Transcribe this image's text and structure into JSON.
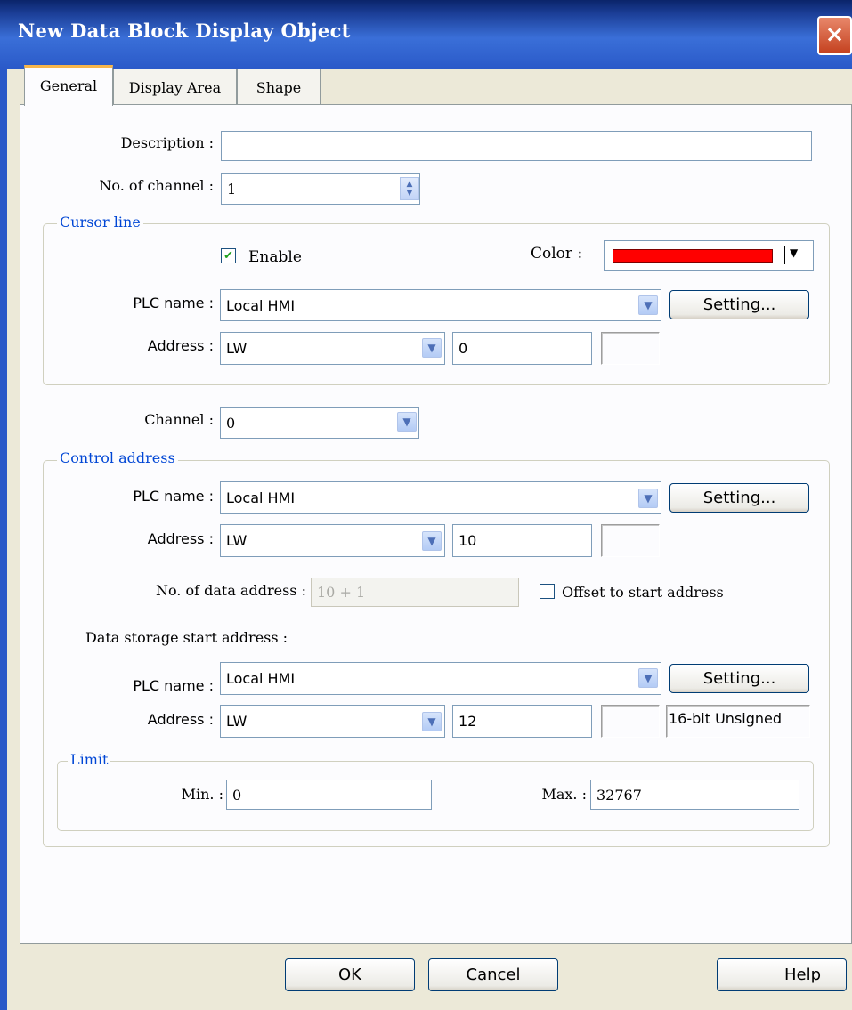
{
  "window": {
    "title": "New  Data Block Display Object",
    "close": "×"
  },
  "tabs": [
    {
      "label": "General",
      "active": true
    },
    {
      "label": "Display Area",
      "active": false
    },
    {
      "label": "Shape",
      "active": false
    }
  ],
  "general": {
    "description_label": "Description :",
    "description_value": "",
    "channels_label": "No. of channel :",
    "channels_value": "1"
  },
  "cursor_line": {
    "title": "Cursor line",
    "enable_label": "Enable",
    "enable_checked": true,
    "color_label": "Color :",
    "color_value": "#ff0000",
    "plc_label": "PLC name :",
    "plc_value": "Local HMI",
    "setting_label": "Setting...",
    "address_label": "Address :",
    "address_device": "LW",
    "address_value": "0"
  },
  "channel": {
    "label": "Channel :",
    "value": "0"
  },
  "control_address": {
    "title": "Control address",
    "plc_label": "PLC name :",
    "plc_value": "Local HMI",
    "setting_label": "Setting...",
    "address_label": "Address :",
    "address_device": "LW",
    "address_value": "10",
    "data_count_label": "No. of data address :",
    "data_count_value": "10 + 1",
    "offset_label": "Offset to start address",
    "offset_checked": false
  },
  "data_storage": {
    "title": "Data storage start address :",
    "plc_label": "PLC name :",
    "plc_value": "Local HMI",
    "setting_label": "Setting...",
    "address_label": "Address :",
    "address_device": "LW",
    "address_value": "12",
    "format": "16-bit Unsigned"
  },
  "limit": {
    "title": "Limit",
    "min_label": "Min. :",
    "min_value": "0",
    "max_label": "Max. :",
    "max_value": "32767"
  },
  "footer": {
    "ok": "OK",
    "cancel": "Cancel",
    "help": "Help"
  },
  "icons": {
    "dropdown": "chevron-down-icon",
    "spinner": "spinner-icon",
    "check": "check-icon",
    "close": "close-icon"
  }
}
